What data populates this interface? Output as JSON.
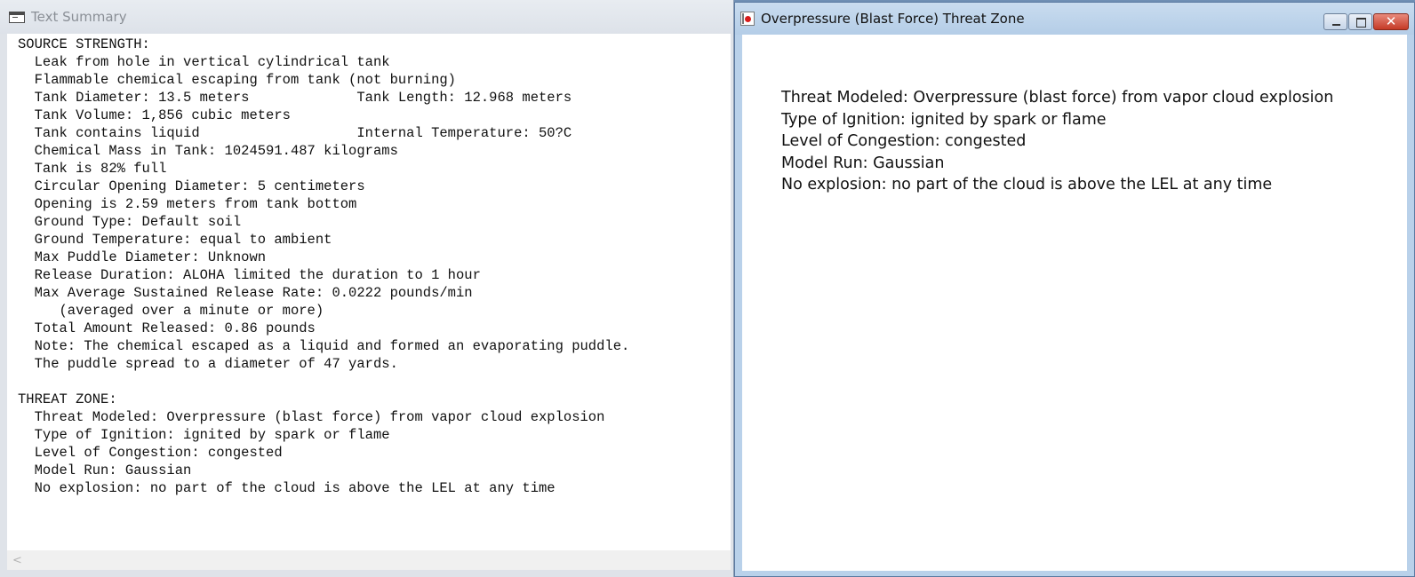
{
  "left_window": {
    "title": "Text Summary",
    "lines": [
      "SOURCE STRENGTH:",
      "  Leak from hole in vertical cylindrical tank",
      "  Flammable chemical escaping from tank (not burning)",
      "  Tank Diameter: 13.5 meters             Tank Length: 12.968 meters",
      "  Tank Volume: 1,856 cubic meters",
      "  Tank contains liquid                   Internal Temperature: 50?C",
      "  Chemical Mass in Tank: 1024591.487 kilograms",
      "  Tank is 82% full",
      "  Circular Opening Diameter: 5 centimeters",
      "  Opening is 2.59 meters from tank bottom",
      "  Ground Type: Default soil",
      "  Ground Temperature: equal to ambient",
      "  Max Puddle Diameter: Unknown",
      "  Release Duration: ALOHA limited the duration to 1 hour",
      "  Max Average Sustained Release Rate: 0.0222 pounds/min",
      "     (averaged over a minute or more)",
      "  Total Amount Released: 0.86 pounds",
      "  Note: The chemical escaped as a liquid and formed an evaporating puddle.",
      "  The puddle spread to a diameter of 47 yards.",
      "",
      "THREAT ZONE:",
      "  Threat Modeled: Overpressure (blast force) from vapor cloud explosion",
      "  Type of Ignition: ignited by spark or flame",
      "  Level of Congestion: congested",
      "  Model Run: Gaussian",
      "  No explosion: no part of the cloud is above the LEL at any time"
    ],
    "scroll_left_glyph": "<"
  },
  "right_window": {
    "title": "Overpressure (Blast Force) Threat Zone",
    "close_glyph": "✕",
    "lines": [
      "Threat Modeled: Overpressure (blast force) from vapor cloud explosion",
      "Type of Ignition: ignited by spark or flame",
      "Level of Congestion: congested",
      "Model Run: Gaussian",
      "No explosion: no part of the cloud is above the LEL at any time"
    ]
  },
  "icons": {
    "left_app": "text-summary-app-icon",
    "right_app": "threat-zone-app-icon",
    "minimize": "minimize-icon",
    "restore": "restore-icon",
    "close": "close-icon"
  },
  "colors": {
    "close_button": "#c53a26",
    "right_titlebar": "#b9d1ea",
    "left_titlebar": "#dfe3e9"
  }
}
